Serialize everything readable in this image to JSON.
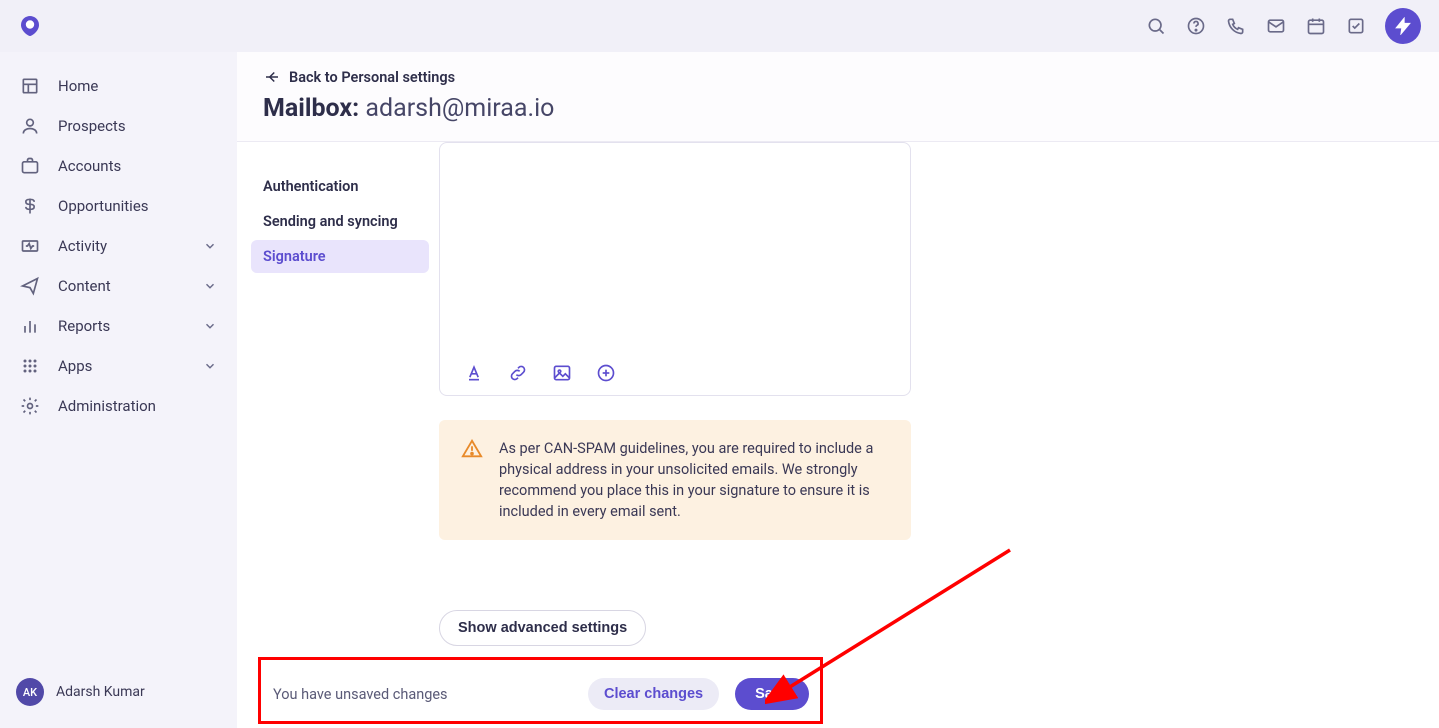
{
  "header": {
    "icons": [
      "search",
      "help",
      "phone",
      "mail",
      "calendar",
      "task"
    ]
  },
  "sidebar": {
    "items": [
      {
        "label": "Home",
        "icon": "home",
        "expandable": false
      },
      {
        "label": "Prospects",
        "icon": "person",
        "expandable": false
      },
      {
        "label": "Accounts",
        "icon": "briefcase",
        "expandable": false
      },
      {
        "label": "Opportunities",
        "icon": "dollar",
        "expandable": false
      },
      {
        "label": "Activity",
        "icon": "activity",
        "expandable": true
      },
      {
        "label": "Content",
        "icon": "send",
        "expandable": true
      },
      {
        "label": "Reports",
        "icon": "bar",
        "expandable": true
      },
      {
        "label": "Apps",
        "icon": "grid",
        "expandable": true
      },
      {
        "label": "Administration",
        "icon": "gear",
        "expandable": false
      }
    ],
    "user": {
      "initials": "AK",
      "name": "Adarsh Kumar"
    }
  },
  "page": {
    "back_label": "Back to Personal settings",
    "title_prefix": "Mailbox:",
    "title_email": "adarsh@miraa.io"
  },
  "tabs": [
    {
      "label": "Authentication",
      "active": false
    },
    {
      "label": "Sending and syncing",
      "active": false
    },
    {
      "label": "Signature",
      "active": true
    }
  ],
  "warning": {
    "text": "As per CAN-SPAM guidelines, you are required to include a physical address in your unsolicited emails. We strongly recommend you place this in your signature to ensure it is included in every email sent."
  },
  "advanced_button": "Show advanced settings",
  "footer": {
    "message": "You have unsaved changes",
    "clear_label": "Clear changes",
    "save_label": "Save"
  },
  "colors": {
    "accent": "#5c4dcf",
    "warn_bg": "#fdf1e1",
    "warn_icon": "#e88a2a"
  }
}
